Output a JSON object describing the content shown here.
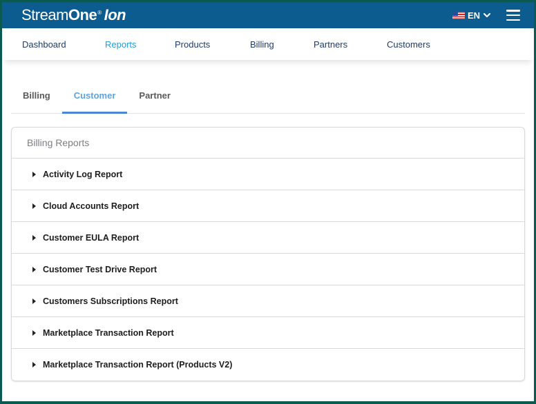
{
  "app": {
    "logo_stream": "Stream",
    "logo_one": "One",
    "logo_reg": "®",
    "logo_ion": "Ion",
    "language": "EN"
  },
  "main_nav": [
    {
      "label": "Dashboard",
      "active": false
    },
    {
      "label": "Reports",
      "active": true
    },
    {
      "label": "Products",
      "active": false
    },
    {
      "label": "Billing",
      "active": false
    },
    {
      "label": "Partners",
      "active": false
    },
    {
      "label": "Customers",
      "active": false
    }
  ],
  "sub_tabs": [
    {
      "label": "Billing",
      "active": false
    },
    {
      "label": "Customer",
      "active": true
    },
    {
      "label": "Partner",
      "active": false
    }
  ],
  "panel": {
    "title": "Billing Reports",
    "reports": [
      "Activity Log Report",
      "Cloud Accounts Report",
      "Customer EULA Report",
      "Customer Test Drive Report",
      "Customers Subscriptions Report",
      "Marketplace Transaction Report",
      "Marketplace Transaction Report (Products V2)"
    ]
  },
  "colors": {
    "topbar": "#0d5c8f",
    "nav_active": "#2b9bd3",
    "nav_text": "#1f3b68",
    "subtab_active": "#5aa4e0",
    "subtab_underline": "#4a86d6",
    "frame_border": "#0b5a52"
  },
  "icons": {
    "flag": "us-flag-icon",
    "chevron": "chevron-down-icon",
    "menu": "hamburger-menu-icon",
    "caret": "caret-right-icon"
  }
}
